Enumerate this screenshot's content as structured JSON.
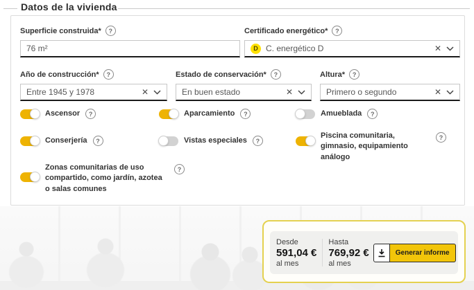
{
  "page": {
    "title": "Datos de la vivienda"
  },
  "icons": {
    "help": "?",
    "clear": "✕",
    "chevron": "chevron-down",
    "download": "download-arrow"
  },
  "form": {
    "fields": {
      "superficie": {
        "label": "Superficie construida*",
        "value": "76 m²"
      },
      "certificado": {
        "label": "Certificado energético*",
        "value": "C. energético D",
        "badge": "D"
      },
      "anio": {
        "label": "Año de construcción*",
        "value": "Entre 1945 y 1978"
      },
      "estado": {
        "label": "Estado de conservación*",
        "value": "En buen estado"
      },
      "altura": {
        "label": "Altura*",
        "value": "Primero o segundo"
      }
    },
    "toggles": {
      "ascensor": {
        "label": "Ascensor",
        "on": true
      },
      "aparcamiento": {
        "label": "Aparcamiento",
        "on": true
      },
      "amueblada": {
        "label": "Amueblada",
        "on": false
      },
      "conserjeria": {
        "label": "Conserjería",
        "on": true
      },
      "vistas": {
        "label": "Vistas especiales",
        "on": false
      },
      "piscina": {
        "label": "Piscina comunitaria, gimnasio, equipamiento análogo",
        "on": true
      },
      "zonas": {
        "label": "Zonas comunitarias de uso compartido, como jardín, azotea o salas comunes",
        "on": true
      }
    }
  },
  "results": {
    "from_label": "Desde",
    "from_value": "591,04 €",
    "to_label": "Hasta",
    "to_value": "769,92 €",
    "per_label": "al mes",
    "generate_button": "Generar informe"
  },
  "colors": {
    "toggle_on": "#eeb303",
    "button_yellow": "#f2c50a",
    "panel_border": "#e4d14f",
    "energy_d_badge": "#ffe100"
  }
}
